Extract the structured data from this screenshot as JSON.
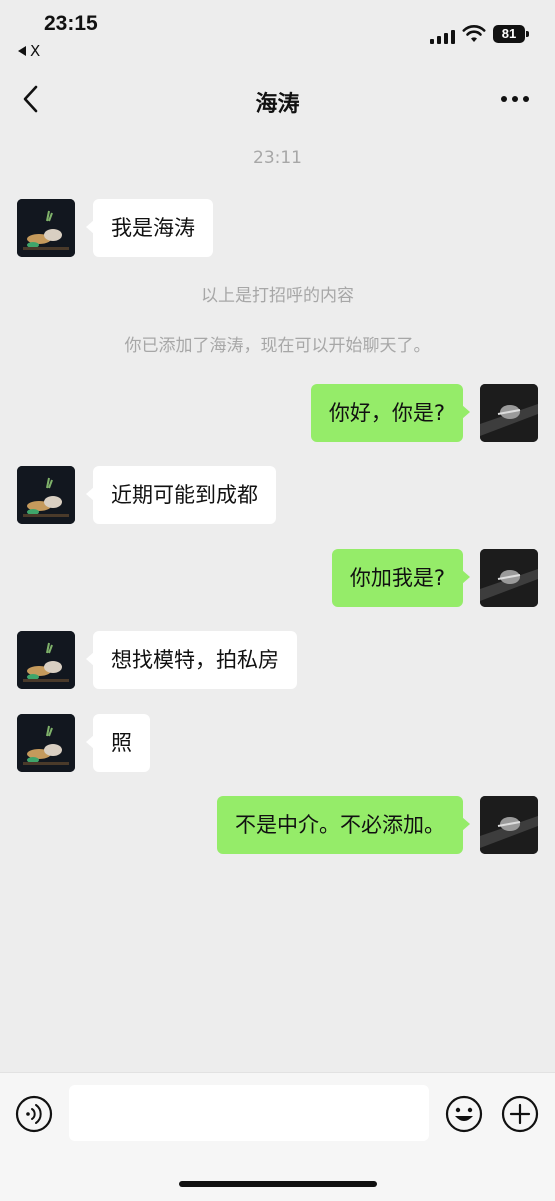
{
  "status": {
    "time": "23:15",
    "back_app": "X",
    "battery": "81"
  },
  "nav": {
    "title": "海涛"
  },
  "timestamp": "23:11",
  "system_messages": [
    "以上是打招呼的内容",
    "你已添加了海涛，现在可以开始聊天了。"
  ],
  "messages": [
    {
      "side": "left",
      "text": "我是海涛"
    },
    {
      "side": "right",
      "text": "你好，你是?"
    },
    {
      "side": "left",
      "text": "近期可能到成都"
    },
    {
      "side": "right",
      "text": "你加我是?"
    },
    {
      "side": "left",
      "text": "想找模特，拍私房"
    },
    {
      "side": "left",
      "text": "照"
    },
    {
      "side": "right",
      "text": "不是中介。不必添加。"
    }
  ],
  "colors": {
    "background": "#ededed",
    "bubble_self": "#95ec69",
    "bubble_other": "#ffffff",
    "system_text": "#a7a7a7"
  },
  "icons": [
    "back-icon",
    "more-icon",
    "voice-icon",
    "emoji-icon",
    "plus-icon"
  ]
}
